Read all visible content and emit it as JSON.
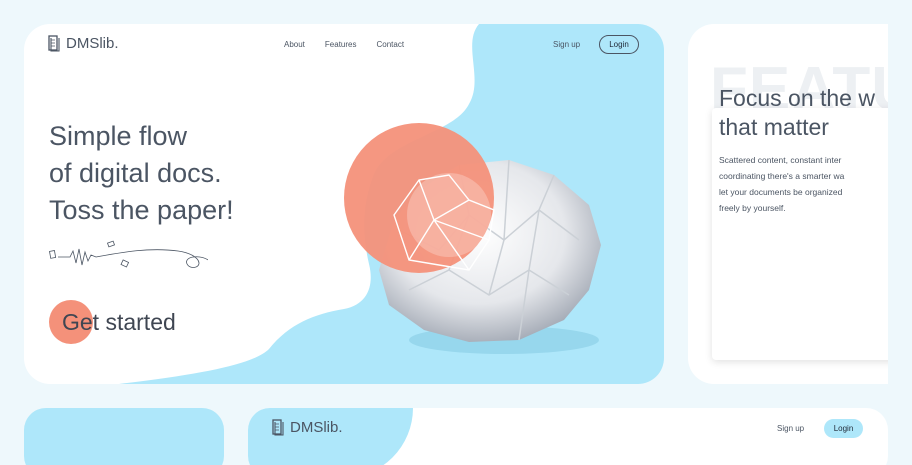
{
  "hero": {
    "logo_text": "DMSlib.",
    "nav": [
      "About",
      "Features",
      "Contact"
    ],
    "signup_label": "Sign up",
    "login_label": "Login",
    "headline": [
      "Simple flow",
      "of digital docs.",
      "Toss the paper!"
    ],
    "cta_label": "Get started"
  },
  "features": {
    "bg_word": "FEATU",
    "title": [
      "Focus on the w",
      "that matter"
    ],
    "body": [
      "Scattered content, constant inter",
      "coordinating there's a smarter wa",
      "let your documents be organized",
      "freely by yourself."
    ]
  },
  "bottom": {
    "logo_text": "DMSlib.",
    "signup_label": "Sign up",
    "login_label": "Login"
  },
  "colors": {
    "accent_blue": "#aee7fa",
    "accent_coral": "#f4917a",
    "page_bg": "#eef8fc"
  }
}
